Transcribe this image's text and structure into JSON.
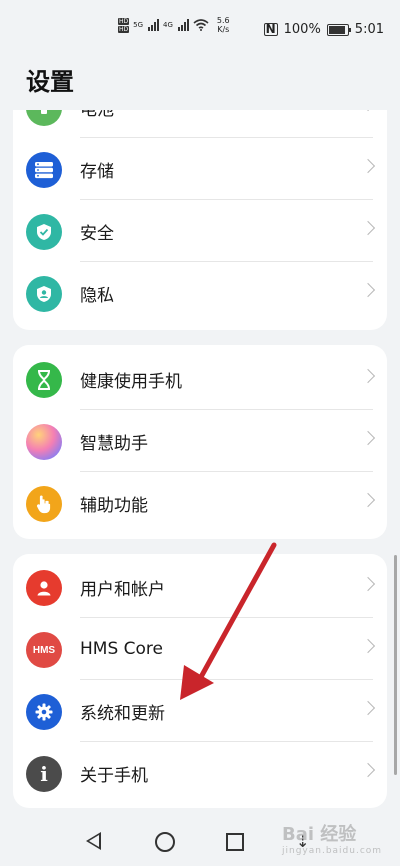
{
  "status_bar": {
    "hd1": "HD",
    "hd2": "HD",
    "net1": "5G",
    "net2": "4G",
    "speed_value": "5.6",
    "speed_unit": "K/s",
    "battery": "100%",
    "battery_level": 1.0,
    "time": "5:01"
  },
  "page_title": "设置",
  "groups": [
    {
      "items": [
        {
          "label": "电池",
          "icon": "battery-icon",
          "color": "#5cb85c"
        },
        {
          "label": "存储",
          "icon": "storage-icon",
          "color": "#1e5fd6"
        },
        {
          "label": "安全",
          "icon": "shield-icon",
          "color": "#2fb7a4"
        },
        {
          "label": "隐私",
          "icon": "privacy-icon",
          "color": "#2fb7a4"
        }
      ]
    },
    {
      "items": [
        {
          "label": "健康使用手机",
          "icon": "hourglass-icon",
          "color": "#35b84a"
        },
        {
          "label": "智慧助手",
          "icon": "assistant-icon",
          "color": "#e86ab8"
        },
        {
          "label": "辅助功能",
          "icon": "hand-icon",
          "color": "#f2a51a"
        }
      ]
    },
    {
      "items": [
        {
          "label": "用户和帐户",
          "icon": "user-icon",
          "color": "#e63b2e"
        },
        {
          "label": "HMS Core",
          "icon": "hms-icon",
          "color": "#e04a44"
        },
        {
          "label": "系统和更新",
          "icon": "gear-icon",
          "color": "#1e5fd6"
        },
        {
          "label": "关于手机",
          "icon": "info-icon",
          "color": "#4b4b4b"
        }
      ]
    }
  ],
  "hms_text": "HMS",
  "info_text": "i",
  "watermark": {
    "text": "Bai 经验",
    "sub": "jingyan.baidu.com"
  }
}
